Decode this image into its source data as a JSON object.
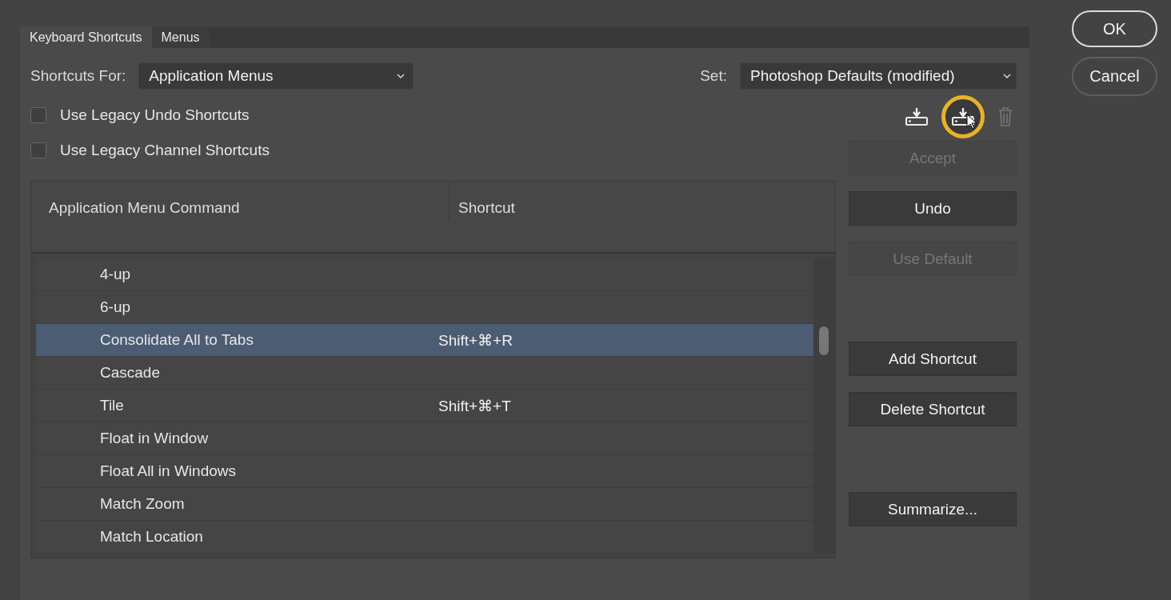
{
  "tabs": [
    {
      "label": "Keyboard Shortcuts",
      "selected": true
    },
    {
      "label": "Menus",
      "selected": false
    }
  ],
  "shortcuts_for": {
    "label": "Shortcuts For:",
    "value": "Application Menus"
  },
  "set": {
    "label": "Set:",
    "value": "Photoshop Defaults (modified)"
  },
  "checkboxes": [
    {
      "label": "Use Legacy Undo Shortcuts",
      "checked": false
    },
    {
      "label": "Use Legacy Channel Shortcuts",
      "checked": false
    }
  ],
  "set_tools": [
    {
      "kind": "save",
      "disabled": false,
      "highlighted": false
    },
    {
      "kind": "save_as",
      "disabled": false,
      "highlighted": true
    },
    {
      "kind": "delete",
      "disabled": true,
      "highlighted": false
    }
  ],
  "table": {
    "columns": [
      "Application Menu Command",
      "Shortcut"
    ],
    "rows": [
      {
        "command": "4-up",
        "shortcut": "",
        "selected": false
      },
      {
        "command": "6-up",
        "shortcut": "",
        "selected": false
      },
      {
        "command": "Consolidate All to Tabs",
        "shortcut": "Shift+⌘+R",
        "selected": true
      },
      {
        "command": "Cascade",
        "shortcut": "",
        "selected": false
      },
      {
        "command": "Tile",
        "shortcut": "Shift+⌘+T",
        "selected": false
      },
      {
        "command": "Float in Window",
        "shortcut": "",
        "selected": false
      },
      {
        "command": "Float All in Windows",
        "shortcut": "",
        "selected": false
      },
      {
        "command": "Match Zoom",
        "shortcut": "",
        "selected": false
      },
      {
        "command": "Match Location",
        "shortcut": "",
        "selected": false
      }
    ]
  },
  "button_groups": [
    [
      {
        "label": "Accept",
        "disabled": true
      },
      {
        "label": "Undo",
        "disabled": false
      },
      {
        "label": "Use Default",
        "disabled": true
      }
    ],
    [
      {
        "label": "Add Shortcut",
        "disabled": false
      },
      {
        "label": "Delete Shortcut",
        "disabled": false
      }
    ],
    [
      {
        "label": "Summarize...",
        "disabled": false
      }
    ]
  ],
  "dialog_buttons": [
    {
      "label": "OK",
      "default": true
    },
    {
      "label": "Cancel",
      "default": false
    }
  ]
}
